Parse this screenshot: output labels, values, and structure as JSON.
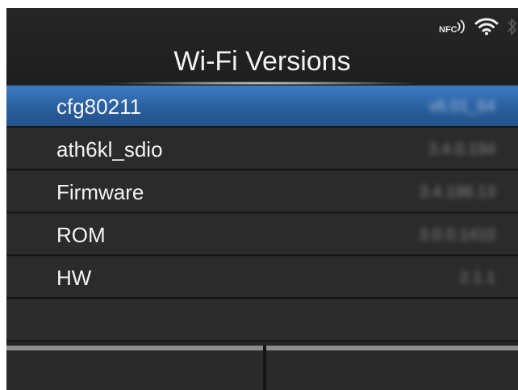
{
  "header": {
    "title": "Wi-Fi Versions",
    "status_icons": [
      "nfc-icon",
      "wifi-icon",
      "bluetooth-icon"
    ],
    "nfc_label": "NFC"
  },
  "list": {
    "items": [
      {
        "label": "cfg80211",
        "value": "v6.01_64",
        "selected": true
      },
      {
        "label": "ath6kl_sdio",
        "value": "3.4.0.194",
        "selected": false
      },
      {
        "label": "Firmware",
        "value": "3.4.196.13",
        "selected": false
      },
      {
        "label": "ROM",
        "value": "3.0.0.1410",
        "selected": false
      },
      {
        "label": "HW",
        "value": "2.1.1",
        "selected": false
      }
    ]
  },
  "footer": {
    "left_softkey": "",
    "right_softkey": ""
  },
  "colors": {
    "selection": "#2a5f9e",
    "background": "#232323",
    "text": "#f4f4f4"
  }
}
